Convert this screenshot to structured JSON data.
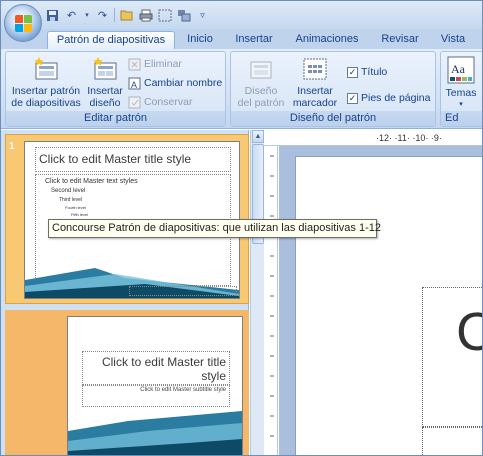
{
  "ribbon_tabs": [
    {
      "label": "Patrón de diapositivas",
      "active": true
    },
    {
      "label": "Inicio",
      "active": false
    },
    {
      "label": "Insertar",
      "active": false
    },
    {
      "label": "Animaciones",
      "active": false
    },
    {
      "label": "Revisar",
      "active": false
    },
    {
      "label": "Vista",
      "active": false
    }
  ],
  "groups": {
    "editar_patron": {
      "label": "Editar patrón",
      "insert_master_line1": "Insertar patrón",
      "insert_master_line2": "de diapositivas",
      "insert_layout_line1": "Insertar",
      "insert_layout_line2": "diseño",
      "delete": "Eliminar",
      "rename": "Cambiar nombre",
      "preserve": "Conservar"
    },
    "diseno_patron": {
      "label": "Diseño del patrón",
      "master_layout_line1": "Diseño",
      "master_layout_line2": "del patrón",
      "insert_placeholder_line1": "Insertar",
      "insert_placeholder_line2": "marcador",
      "title_check": "Título",
      "footer_check": "Pies de página",
      "title_checked": true,
      "footer_checked": true
    },
    "editar_tema": {
      "label": "Ed",
      "themes": "Temas",
      "theme_icon_text": "Aa"
    }
  },
  "thumbnails": {
    "slide_number": "1",
    "master": {
      "title": "Click to edit Master title style",
      "body_l1": "Click to edit Master text styles",
      "body_l2": "Second level",
      "body_l3": "Third level",
      "body_l4": "Fourth level",
      "body_l5": "Fifth level"
    },
    "layout": {
      "title": "Click to edit Master title style",
      "subtitle": "Click to edit Master subtitle style"
    }
  },
  "tooltip": "Concourse Patrón de diapositivas: que utilizan las diapositivas 1-12",
  "ruler_text": "·12· ·11· ·10· ·9·",
  "big_slide_glyph": "C",
  "colors": {
    "accent": "#15428b",
    "selected_slot": "#f8c873",
    "ribbon_bg": "#dbe7f7",
    "slide_band": "#2a7da0"
  }
}
